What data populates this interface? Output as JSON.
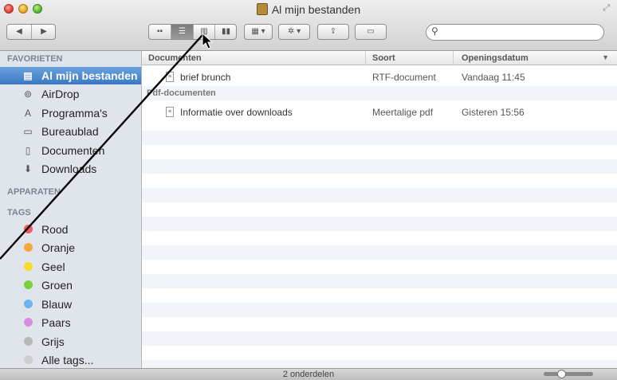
{
  "window": {
    "title": "Al mijn bestanden",
    "title_icon": "all-my-files-icon",
    "traffic_lights": [
      "close",
      "minimize",
      "zoom"
    ]
  },
  "toolbar": {
    "back_label": "◀",
    "forward_label": "▶",
    "view_icons": [
      "icon-view-icon",
      "list-view-icon",
      "column-view-icon",
      "coverflow-view-icon"
    ],
    "active_view": "list-view-icon",
    "arrange_icon": "arrange-icon",
    "action_icon": "gear-icon",
    "share_icon": "share-icon",
    "tags_icon": "tag-icon",
    "search_placeholder": ""
  },
  "sidebar": {
    "favorites_header": "FAVORIETEN",
    "favorites": [
      {
        "label": "Al mijn bestanden",
        "icon": "all-files-icon",
        "selected": true
      },
      {
        "label": "AirDrop",
        "icon": "airdrop-icon",
        "selected": false
      },
      {
        "label": "Programma's",
        "icon": "applications-icon",
        "selected": false
      },
      {
        "label": "Bureaublad",
        "icon": "desktop-icon",
        "selected": false
      },
      {
        "label": "Documenten",
        "icon": "documents-icon",
        "selected": false
      },
      {
        "label": "Downloads",
        "icon": "downloads-icon",
        "selected": false
      }
    ],
    "devices_header": "APPARATEN",
    "tags_header": "TAGS",
    "tags": [
      {
        "label": "Rood",
        "color": "#f2585f"
      },
      {
        "label": "Oranje",
        "color": "#f8a73a"
      },
      {
        "label": "Geel",
        "color": "#f6db2f"
      },
      {
        "label": "Groen",
        "color": "#7cd03b"
      },
      {
        "label": "Blauw",
        "color": "#6ab4ef"
      },
      {
        "label": "Paars",
        "color": "#dc8ce0"
      },
      {
        "label": "Grijs",
        "color": "#b8b8b8"
      },
      {
        "label": "Alle tags...",
        "color": "#cfcfcf"
      }
    ]
  },
  "list": {
    "columns": {
      "name": "Documenten",
      "kind": "Soort",
      "date": "Openingsdatum"
    },
    "rows": [
      {
        "type": "file",
        "name": "brief brunch",
        "kind": "RTF-document",
        "date": "Vandaag 11:45"
      },
      {
        "type": "group",
        "name": "Pdf-documenten"
      },
      {
        "type": "file",
        "name": "Informatie over downloads",
        "kind": "Meertalige pdf",
        "date": "Gisteren 15:56"
      }
    ]
  },
  "statusbar": {
    "item_count": "2 onderdelen",
    "zoom_level": 0.3
  },
  "colors": {
    "selection": "#3c78c4",
    "sidebar_bg": "#e0e5ec",
    "row_alt": "#f1f5fa",
    "page_bg": "#f3e6a6"
  }
}
